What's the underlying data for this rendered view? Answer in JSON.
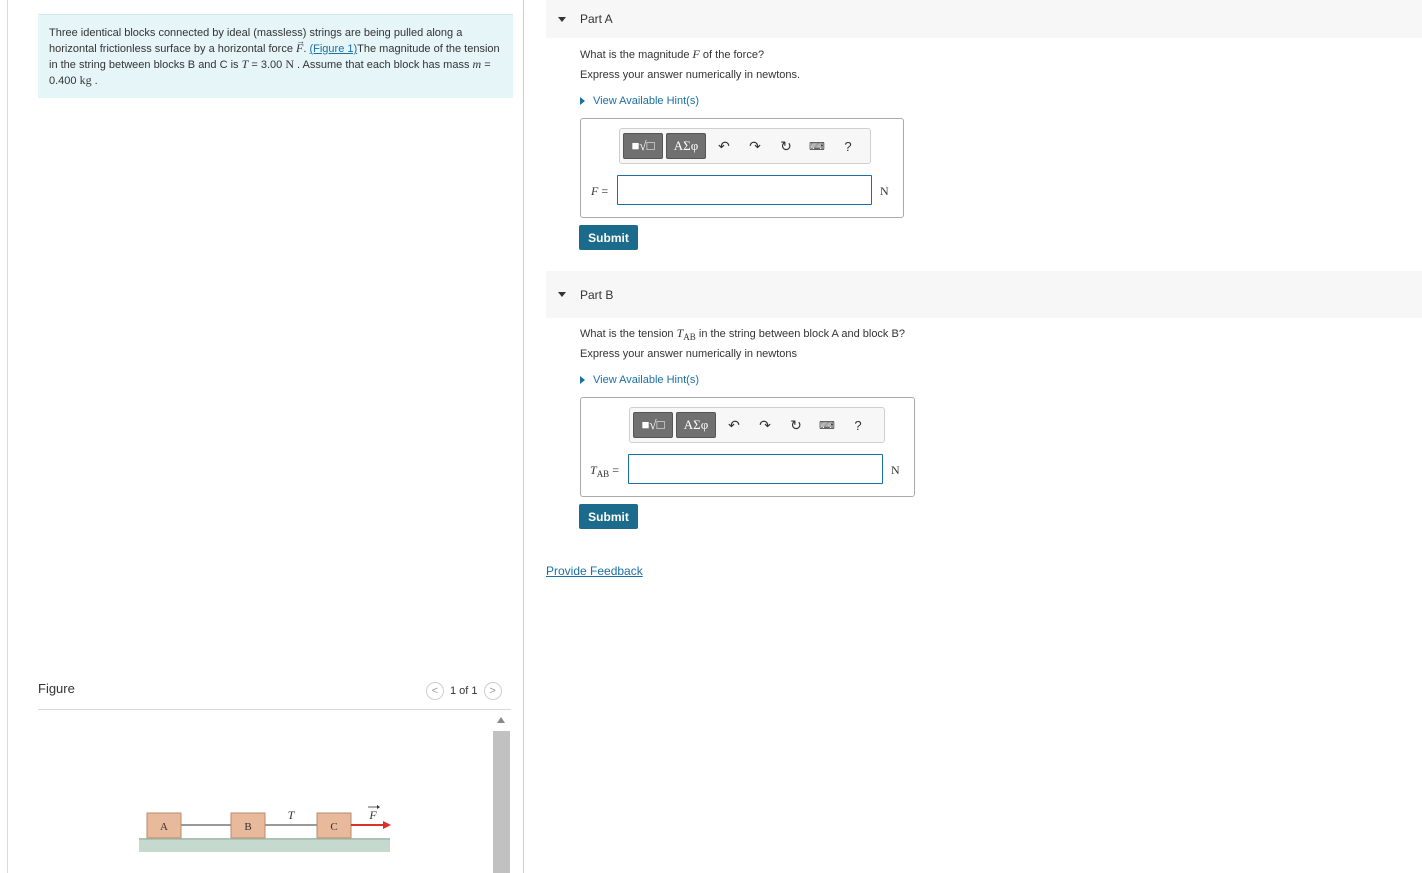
{
  "problem": {
    "line1": "Three identical blocks connected by ideal (massless) strings are being pulled along a",
    "line2_before": "horizontal frictionless surface by a horizontal force ",
    "force_symbol": "F",
    "line2_after": ". ",
    "figure_link": "(Figure 1)",
    "line2_tail": "The magnitude of the tension",
    "line3_before": "in the string between blocks B and C is ",
    "tension_symbol": "T",
    "tension_value": " = 3.00 ",
    "tension_unit": "N",
    "line3_mid": " . Assume that each block has mass ",
    "mass_symbol": "m",
    "line3_after": " =",
    "mass_value": "0.400 ",
    "mass_unit": "kg",
    "mass_tail": " ."
  },
  "figure": {
    "title": "Figure",
    "pager_prev": "<",
    "pager_text": "1 of 1",
    "pager_next": ">",
    "blocks": [
      "A",
      "B",
      "C"
    ],
    "tension_label": "T",
    "force_label": "F"
  },
  "toolbar": {
    "template_label": "■√□",
    "greek_label": "ΑΣφ",
    "undo_icon": "↶",
    "redo_icon": "↷",
    "reset_icon": "↻",
    "keyboard_icon": "⌨",
    "help_label": "?"
  },
  "partA": {
    "title": "Part A",
    "question_before": "What is the magnitude ",
    "question_symbol": "F",
    "question_after": " of the force?",
    "instruction": "Express your answer numerically in newtons.",
    "hint": "View Available Hint(s)",
    "var_symbol": "F",
    "var_eq": " =",
    "input_value": "",
    "unit": "N",
    "submit": "Submit"
  },
  "partB": {
    "title": "Part B",
    "question_before": "What is the tension ",
    "question_symbol": "T",
    "question_sub": "AB",
    "question_after": " in the string between block A and block B?",
    "instruction": "Express your answer numerically in newtons",
    "hint": "View Available Hint(s)",
    "var_symbol": "T",
    "var_sub": "AB",
    "var_eq": " =",
    "input_value": "",
    "unit": "N",
    "submit": "Submit"
  },
  "feedback": "Provide Feedback",
  "colors": {
    "accent": "#1a6fa5",
    "submit_bg": "#1a6b8c",
    "intro_bg": "#e6f5f8",
    "block_fill": "#e8b99a",
    "force_arrow": "#d9322b"
  }
}
